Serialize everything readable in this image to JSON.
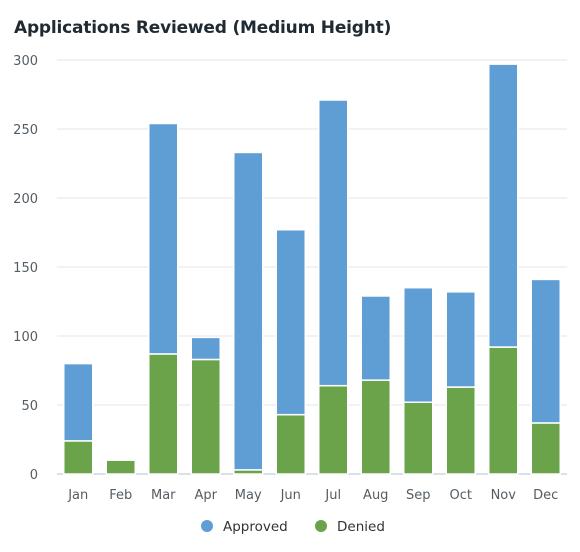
{
  "chart_data": {
    "type": "bar",
    "stacked": true,
    "title": "Applications Reviewed (Medium Height)",
    "xlabel": "",
    "ylabel": "",
    "categories": [
      "Jan",
      "Feb",
      "Mar",
      "Apr",
      "May",
      "Jun",
      "Jul",
      "Aug",
      "Sep",
      "Oct",
      "Nov",
      "Dec"
    ],
    "series": [
      {
        "name": "Denied",
        "color": "#6aa349",
        "values": [
          24,
          10,
          87,
          83,
          3,
          43,
          64,
          68,
          52,
          63,
          92,
          37
        ]
      },
      {
        "name": "Approved",
        "color": "#5f9ed5",
        "values": [
          56,
          0,
          167,
          16,
          230,
          134,
          207,
          61,
          83,
          69,
          205,
          104
        ]
      }
    ],
    "ylim": [
      0,
      300
    ],
    "yticks": [
      0,
      50,
      100,
      150,
      200,
      250,
      300
    ],
    "grid": true,
    "legend": {
      "position": "bottom",
      "entries": [
        "Approved",
        "Denied"
      ]
    }
  }
}
